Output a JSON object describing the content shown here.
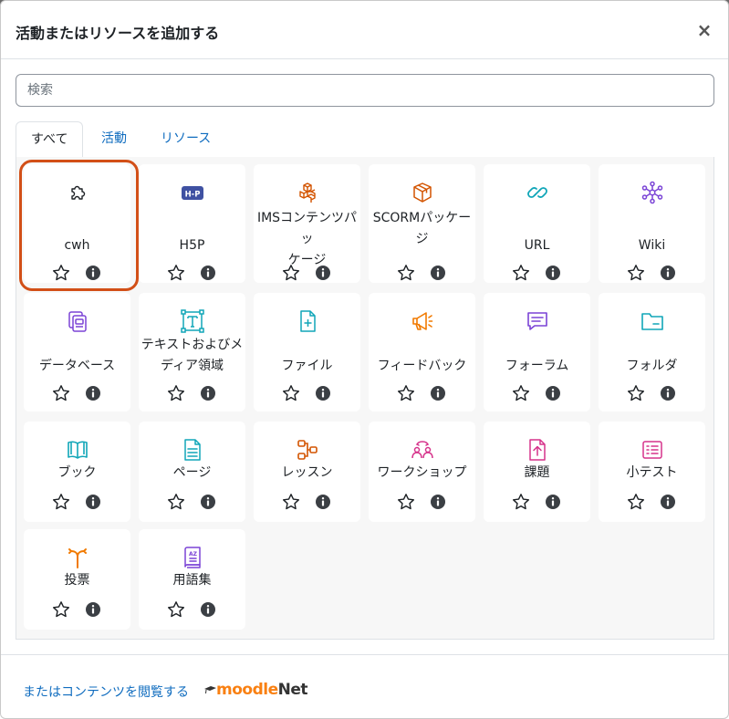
{
  "modal": {
    "title": "活動またはリソースを追加する",
    "close_glyph": "×"
  },
  "search": {
    "placeholder": "検索",
    "value": ""
  },
  "tabs": [
    {
      "label": "すべて",
      "active": true
    },
    {
      "label": "活動",
      "active": false
    },
    {
      "label": "リソース",
      "active": false
    }
  ],
  "items": [
    {
      "name": "cwh",
      "icon": "puzzle-icon",
      "color": "#1d2125"
    },
    {
      "name": "H5P",
      "icon": "h5p-icon",
      "color": "#3f51a2"
    },
    {
      "name": "IMSコンテンツパッケージ",
      "icon": "cubes-icon",
      "color": "#d35400"
    },
    {
      "name": "SCORMパッケージ",
      "icon": "package-box-icon",
      "color": "#d35400"
    },
    {
      "name": "URL",
      "icon": "link-icon",
      "color": "#11a6b8"
    },
    {
      "name": "Wiki",
      "icon": "network-icon",
      "color": "#7b44d6"
    },
    {
      "name": "データベース",
      "icon": "database-icon",
      "color": "#7b44d6"
    },
    {
      "name": "テキストおよびメディア領域",
      "icon": "text-media-icon",
      "color": "#11a6b8"
    },
    {
      "name": "ファイル",
      "icon": "file-add-icon",
      "color": "#11a6b8"
    },
    {
      "name": "フィードバック",
      "icon": "megaphone-icon",
      "color": "#f17a00"
    },
    {
      "name": "フォーラム",
      "icon": "forum-icon",
      "color": "#7b44d6"
    },
    {
      "name": "フォルダ",
      "icon": "folder-icon",
      "color": "#11a6b8"
    },
    {
      "name": "ブック",
      "icon": "book-icon",
      "color": "#11a6b8"
    },
    {
      "name": "ページ",
      "icon": "page-icon",
      "color": "#11a6b8"
    },
    {
      "name": "レッスン",
      "icon": "lesson-icon",
      "color": "#d35400"
    },
    {
      "name": "ワークショップ",
      "icon": "workshop-icon",
      "color": "#d6338b"
    },
    {
      "name": "課題",
      "icon": "assignment-icon",
      "color": "#d6338b"
    },
    {
      "name": "小テスト",
      "icon": "quiz-icon",
      "color": "#d6338b"
    },
    {
      "name": "投票",
      "icon": "choice-icon",
      "color": "#f17a00"
    },
    {
      "name": "用語集",
      "icon": "glossary-icon",
      "color": "#7b44d6"
    }
  ],
  "footer": {
    "link_label": "またはコンテンツを閲覧する",
    "logo_moodle": "moodle",
    "logo_net": "Net"
  },
  "colors": {
    "link": "#0f6cbf",
    "highlight": "#d24f17",
    "panel_bg": "#f7f7f7"
  }
}
